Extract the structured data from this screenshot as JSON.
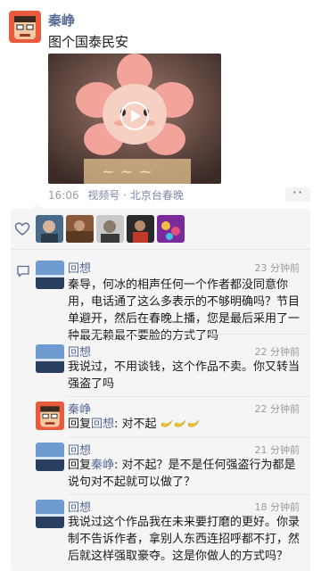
{
  "post": {
    "author": "秦峥",
    "text": "图个国泰民安",
    "time": "16:06",
    "channel": "视频号 · 北京台春晚",
    "more": "··"
  },
  "comments": [
    {
      "name": "回想",
      "time": "23 分钟前",
      "text": "秦导，何冰的相声任何一个作者都没同意你用，电话通了这么多表示的不够明确吗？节目单避开，然后在春晚上播，您是最后采用了一种最无赖最不要脸的方式了吗"
    },
    {
      "name": "回想",
      "time": "22 分钟前",
      "text": "我说过，不用谈钱，这个作品不卖。你又转当强盗了吗"
    },
    {
      "name": "秦峥",
      "time": "22 分钟前",
      "reply_prefix": "回复",
      "reply_to": "回想",
      "reply_text": ": 对不起",
      "emojis": [
        "banana-icon",
        "banana-icon",
        "banana-icon"
      ]
    },
    {
      "name": "回想",
      "time": "21 分钟前",
      "reply_prefix": "回复",
      "reply_to": "秦峥",
      "reply_text": ": 对不起？是不是任何强盗行为都是说句对不起就可以做了？"
    },
    {
      "name": "回想",
      "time": "18 分钟前",
      "text": "我说过这个作品我在未来要打磨的更好。你录制不告诉作者，拿别人东西连招呼都不打，然后就这样强取豪夺。这是你做人的方式吗？"
    }
  ],
  "colors": {
    "name_link": "#576b95",
    "panel_bg": "#f5f5f5",
    "muted": "#9a9a9a"
  }
}
